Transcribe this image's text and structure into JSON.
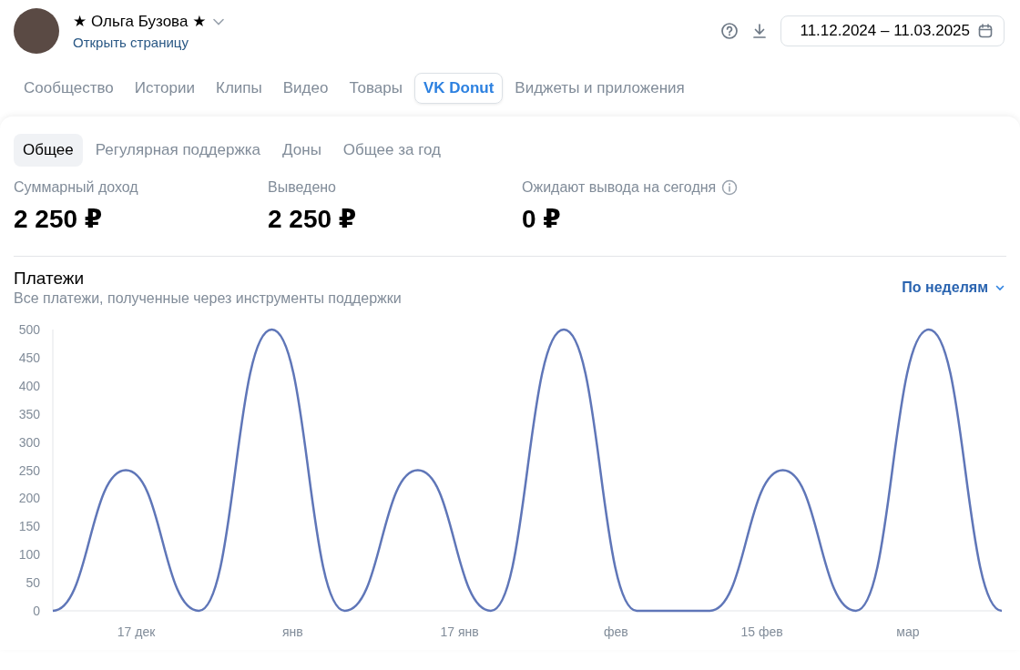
{
  "profile": {
    "name": "★ Ольга Бузова ★",
    "link": "Открыть страницу"
  },
  "date_range": {
    "value": "11.12.2024 – 11.03.2025"
  },
  "tabs": [
    {
      "label": "Сообщество",
      "selected": false
    },
    {
      "label": "Истории",
      "selected": false
    },
    {
      "label": "Клипы",
      "selected": false
    },
    {
      "label": "Видео",
      "selected": false
    },
    {
      "label": "Товары",
      "selected": false
    },
    {
      "label": "VK Donut",
      "selected": true
    },
    {
      "label": "Виджеты и приложения",
      "selected": false
    }
  ],
  "subtabs": [
    {
      "label": "Общее",
      "selected": true
    },
    {
      "label": "Регулярная поддержка",
      "selected": false
    },
    {
      "label": "Доны",
      "selected": false
    },
    {
      "label": "Общее за год",
      "selected": false
    }
  ],
  "stats": [
    {
      "label": "Суммарный доход",
      "value": "2 250 ₽",
      "info": false
    },
    {
      "label": "Выведено",
      "value": "2 250 ₽",
      "info": false
    },
    {
      "label": "Ожидают вывода на сегодня",
      "value": "0 ₽",
      "info": true
    }
  ],
  "payments": {
    "title": "Платежи",
    "subtitle": "Все платежи, полученные через инструменты поддержки",
    "period": "По неделям",
    "chart_data": {
      "type": "line",
      "x": [
        "2024-12-09",
        "2024-12-16",
        "2024-12-23",
        "2024-12-30",
        "2025-01-06",
        "2025-01-13",
        "2025-01-20",
        "2025-01-27",
        "2025-02-03",
        "2025-02-10",
        "2025-02-17",
        "2025-02-24",
        "2025-03-03",
        "2025-03-10"
      ],
      "series": [
        {
          "color": "#5f76b8",
          "values": [
            0,
            250,
            0,
            500,
            0,
            250,
            0,
            500,
            0,
            0,
            250,
            0,
            500,
            0
          ]
        }
      ],
      "xlim": [
        "2024-12-09",
        "2025-03-10"
      ],
      "ylim": [
        0,
        500
      ],
      "xticks": [
        {
          "value": "2024-12-17",
          "label": "17 дек"
        },
        {
          "value": "2025-01-01",
          "label": "янв"
        },
        {
          "value": "2025-01-17",
          "label": "17 янв"
        },
        {
          "value": "2025-02-01",
          "label": "фев"
        },
        {
          "value": "2025-02-15",
          "label": "15 фев"
        },
        {
          "value": "2025-03-01",
          "label": "мар"
        }
      ],
      "yticks": [
        0,
        50,
        100,
        150,
        200,
        250,
        300,
        350,
        400,
        450,
        500
      ]
    }
  }
}
